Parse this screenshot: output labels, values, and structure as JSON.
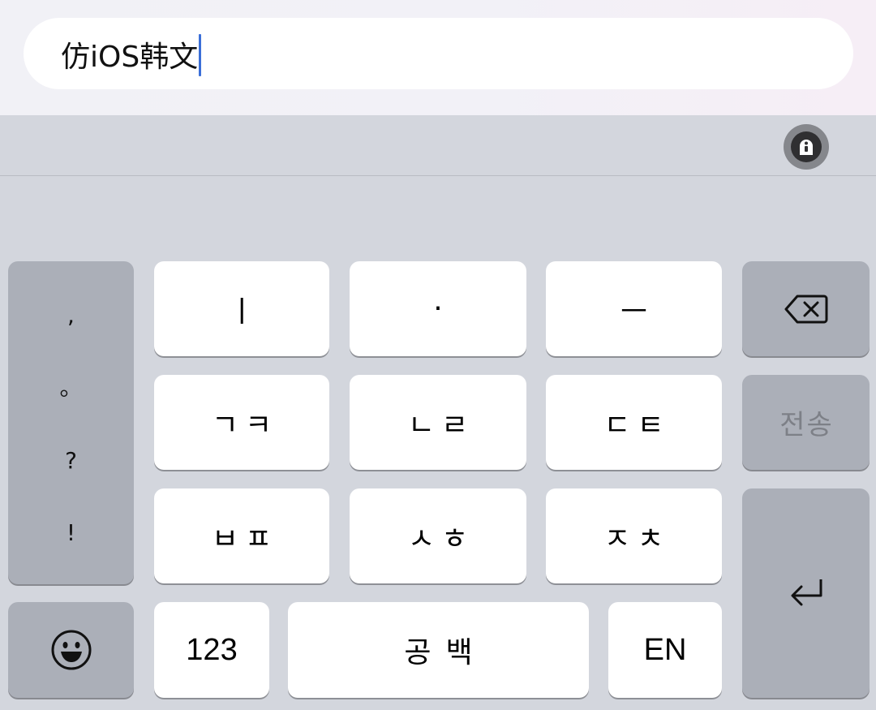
{
  "input_field": {
    "value": "仿iOS韩文"
  },
  "assist_icon": "assistive-touch-icon",
  "keys": {
    "row1": [
      "ㅣ",
      "·",
      "ㅡ"
    ],
    "row2": [
      "ㄱㅋ",
      "ㄴㄹ",
      "ㄷㅌ"
    ],
    "row3": [
      "ㅂㅍ",
      "ㅅㅎ",
      "ㅈㅊ"
    ],
    "punctuation": [
      ",",
      "。",
      "?",
      "!"
    ],
    "numbers": "123",
    "space": "공백",
    "language": "EN",
    "send": "전송",
    "delete_icon": "backspace-icon",
    "emoji_icon": "emoji-icon",
    "return_icon": "return-icon"
  },
  "colors": {
    "keyboard_bg": "#d3d6dd",
    "key_bg": "#ffffff",
    "function_key_bg": "#abafb8",
    "caret": "#3b6fd8"
  }
}
